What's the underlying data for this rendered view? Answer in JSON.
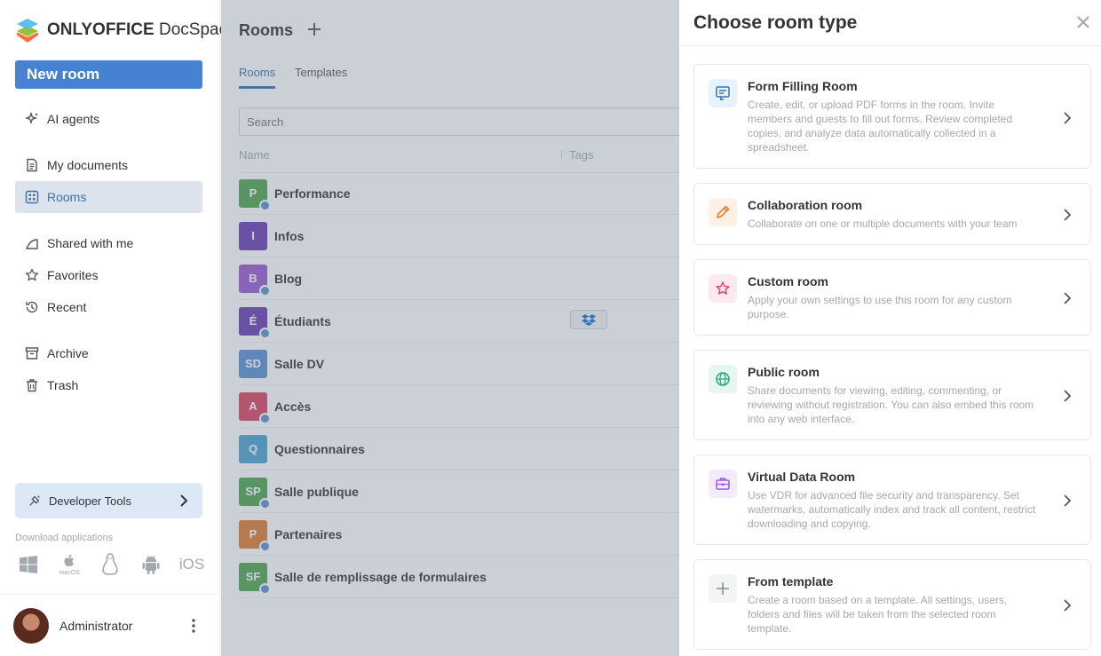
{
  "app": {
    "logo_brand": "ONLYOFFICE",
    "logo_product": "DocSpace"
  },
  "sidebar": {
    "new_room_label": "New room",
    "items": [
      {
        "label": "AI agents",
        "icon": "ai-agents-icon"
      },
      {
        "label": "My documents",
        "icon": "document-icon"
      },
      {
        "label": "Rooms",
        "icon": "rooms-icon",
        "active": true
      },
      {
        "label": "Shared with me",
        "icon": "shared-icon"
      },
      {
        "label": "Favorites",
        "icon": "star-icon"
      },
      {
        "label": "Recent",
        "icon": "history-icon"
      },
      {
        "label": "Archive",
        "icon": "archive-icon"
      },
      {
        "label": "Trash",
        "icon": "trash-icon"
      }
    ],
    "developer_tools_label": "Developer Tools",
    "download_label": "Download applications",
    "apps": [
      "windows-icon",
      "macos-icon",
      "linux-icon",
      "android-icon",
      "ios-icon"
    ],
    "macos_label": "macOS",
    "ios_label": "iOS",
    "user_name": "Administrator"
  },
  "main": {
    "title": "Rooms",
    "tabs": [
      "Rooms",
      "Templates"
    ],
    "search_placeholder": "Search",
    "columns": [
      "Name",
      "Tags"
    ],
    "rooms": [
      {
        "initials": "P",
        "name": "Performance",
        "color": "#50a34d",
        "public": true
      },
      {
        "initials": "I",
        "name": "Infos",
        "color": "#6b3db3",
        "public": false
      },
      {
        "initials": "B",
        "name": "Blog",
        "color": "#9b59d0",
        "public": true
      },
      {
        "initials": "É",
        "name": "Étudiants",
        "color": "#6b3db3",
        "public": true,
        "tag": "dropbox-icon"
      },
      {
        "initials": "SD",
        "name": "Salle DV",
        "color": "#5b8fcf",
        "public": false
      },
      {
        "initials": "A",
        "name": "Accès",
        "color": "#d9435d",
        "public": true
      },
      {
        "initials": "Q",
        "name": "Questionnaires",
        "color": "#4aa3d0",
        "public": false
      },
      {
        "initials": "SP",
        "name": "Salle publique",
        "color": "#50a34d",
        "public": true
      },
      {
        "initials": "P",
        "name": "Partenaires",
        "color": "#e07a2e",
        "public": true
      },
      {
        "initials": "SF",
        "name": "Salle de remplissage de formulaires",
        "color": "#50a34d",
        "public": true
      }
    ]
  },
  "panel": {
    "title": "Choose room type",
    "room_types": [
      {
        "title": "Form Filling Room",
        "description": "Create, edit, or upload PDF forms in the room. Invite members and guests to fill out forms. Review completed copies, and analyze data automatically collected in a spreadsheet.",
        "icon": "form-filling-icon",
        "icon_color": "#3b72a7",
        "icon_bg": "#e6f2fc"
      },
      {
        "title": "Collaboration room",
        "description": "Collaborate on one or multiple documents with your team",
        "icon": "pencil-icon",
        "icon_color": "#f27a2a",
        "icon_bg": "#fdf0e6"
      },
      {
        "title": "Custom room",
        "description": "Apply your own settings to use this room for any custom purpose.",
        "icon": "star-outline-icon",
        "icon_color": "#e2446a",
        "icon_bg": "#fceaef"
      },
      {
        "title": "Public room",
        "description": "Share documents for viewing, editing, commenting, or reviewing without registration. You can also embed this room into any web interface.",
        "icon": "globe-icon",
        "icon_color": "#2fa77e",
        "icon_bg": "#e6f6f0"
      },
      {
        "title": "Virtual Data Room",
        "description": "Use VDR for advanced file security and transparency. Set watermarks, automatically index and track all content, restrict downloading and copying.",
        "icon": "briefcase-icon",
        "icon_color": "#a05ad4",
        "icon_bg": "#f3eafb"
      },
      {
        "title": "From template",
        "description": "Create a room based on a template. All settings, users, folders and files will be taken from the selected room template.",
        "icon": "plus-icon",
        "icon_color": "#8a8f94",
        "icon_bg": "#f3f4f4"
      }
    ]
  }
}
